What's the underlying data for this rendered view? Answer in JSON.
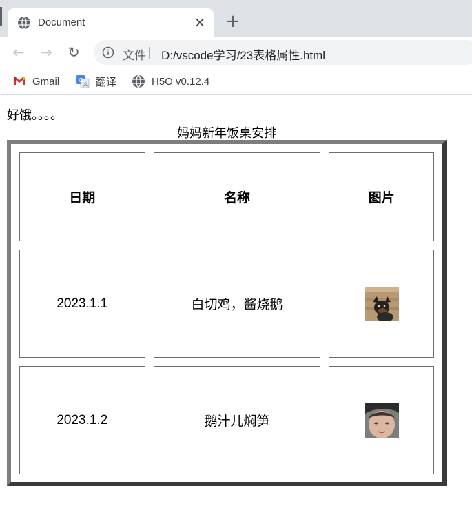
{
  "browser": {
    "tab": {
      "title": "Document",
      "favicon": "globe-icon",
      "close": "×"
    },
    "new_tab": "+",
    "omnibox": {
      "label": "文件",
      "separator": "|",
      "url": "D:/vscode学习/23表格属性.html"
    },
    "bookmarks": [
      {
        "label": "Gmail",
        "icon": "gmail-icon"
      },
      {
        "label": "翻译",
        "icon": "translate-icon"
      },
      {
        "label": "H5O v0.12.4",
        "icon": "globe-icon"
      }
    ]
  },
  "page": {
    "intro": "好饿。。。。",
    "caption": "妈妈新年饭桌安排",
    "table": {
      "headers": [
        "日期",
        "名称",
        "图片"
      ],
      "rows": [
        {
          "date": "2023.1.1",
          "name": "白切鸡，酱烧鹅",
          "image": "dog-photo"
        },
        {
          "date": "2023.1.2",
          "name": "鹅汁儿焖笋",
          "image": "face-photo"
        }
      ]
    }
  }
}
